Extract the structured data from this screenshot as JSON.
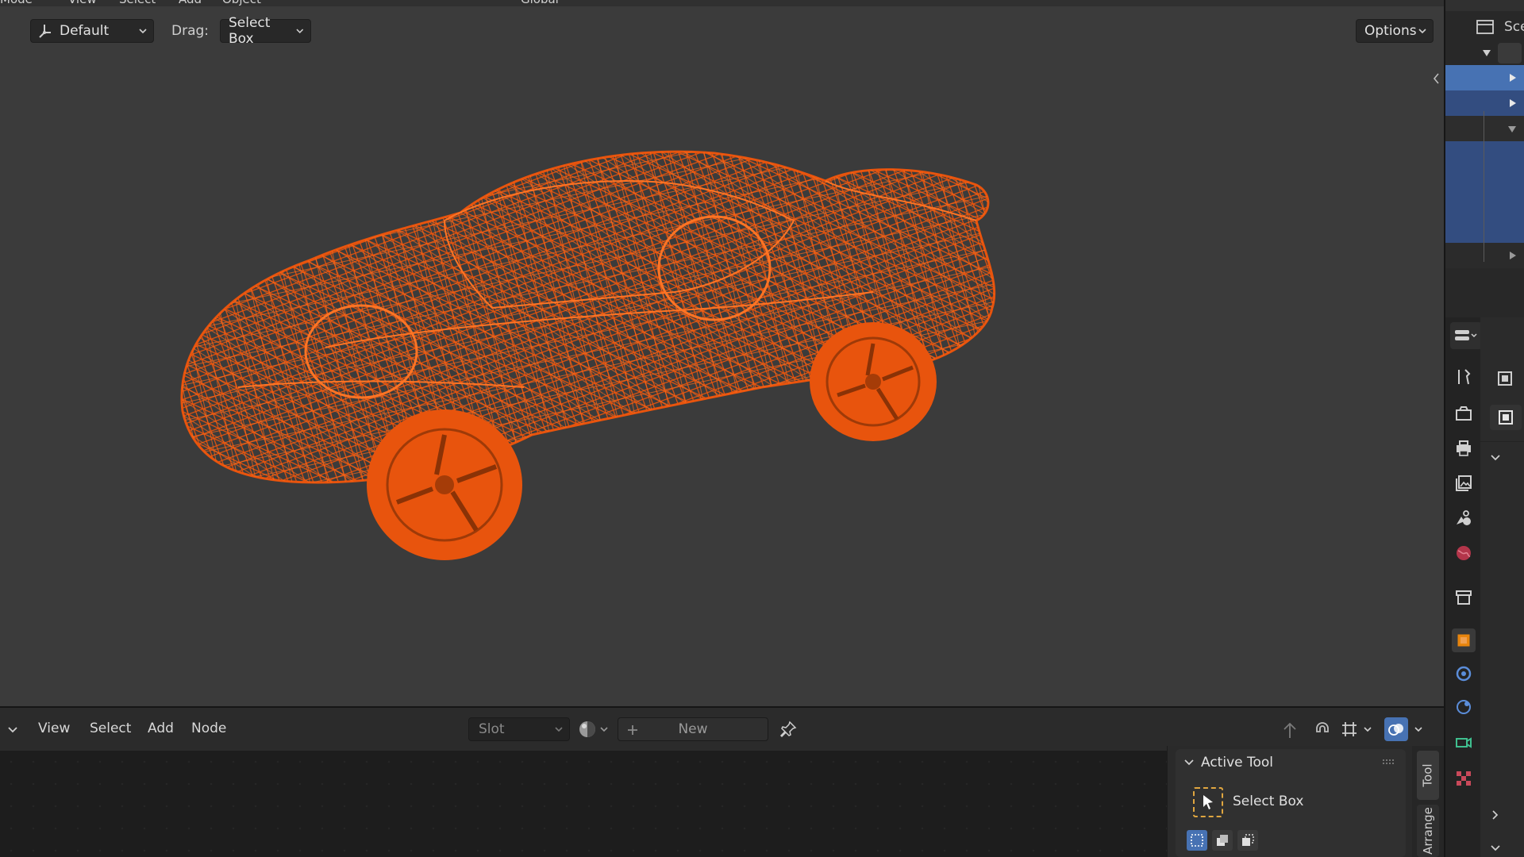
{
  "top_menu_cut": [
    "Mode",
    "View",
    "Select",
    "Add",
    "Object",
    "Global"
  ],
  "viewport_header": {
    "orientation_value": "Default",
    "drag_label": "Drag:",
    "drag_value": "Select Box",
    "options_label": "Options"
  },
  "viewport": {
    "object_color": "#e8540d",
    "background_color": "#3b3b3b"
  },
  "node_editor": {
    "menus": [
      "View",
      "Select",
      "Add",
      "Node"
    ],
    "slot_label": "Slot",
    "new_label": "New"
  },
  "sidebar": {
    "section_title": "Active Tool",
    "tool_name": "Select Box",
    "tabs": [
      "Tool",
      "Arrange"
    ]
  },
  "outliner": {
    "scene_label": "Sce"
  },
  "colors": {
    "selection_blue": "#334d80",
    "accent_orange": "#e8540d"
  }
}
